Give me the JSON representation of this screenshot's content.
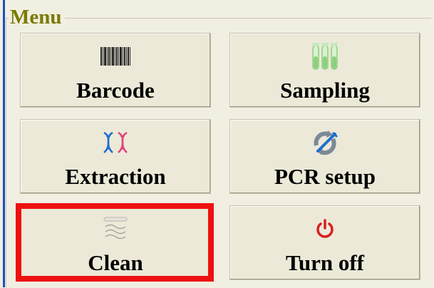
{
  "menu": {
    "title": "Menu",
    "title_color": "#7a7a00"
  },
  "buttons": [
    {
      "label": "Barcode",
      "icon": "barcode-icon"
    },
    {
      "label": "Sampling",
      "icon": "test-tubes-icon"
    },
    {
      "label": "Extraction",
      "icon": "dna-icon"
    },
    {
      "label": "PCR setup",
      "icon": "pipette-cycle-icon"
    },
    {
      "label": "Clean",
      "icon": "uv-lamp-icon",
      "highlighted": true
    },
    {
      "label": "Turn off",
      "icon": "power-icon"
    }
  ],
  "highlight_color": "#ee1111"
}
